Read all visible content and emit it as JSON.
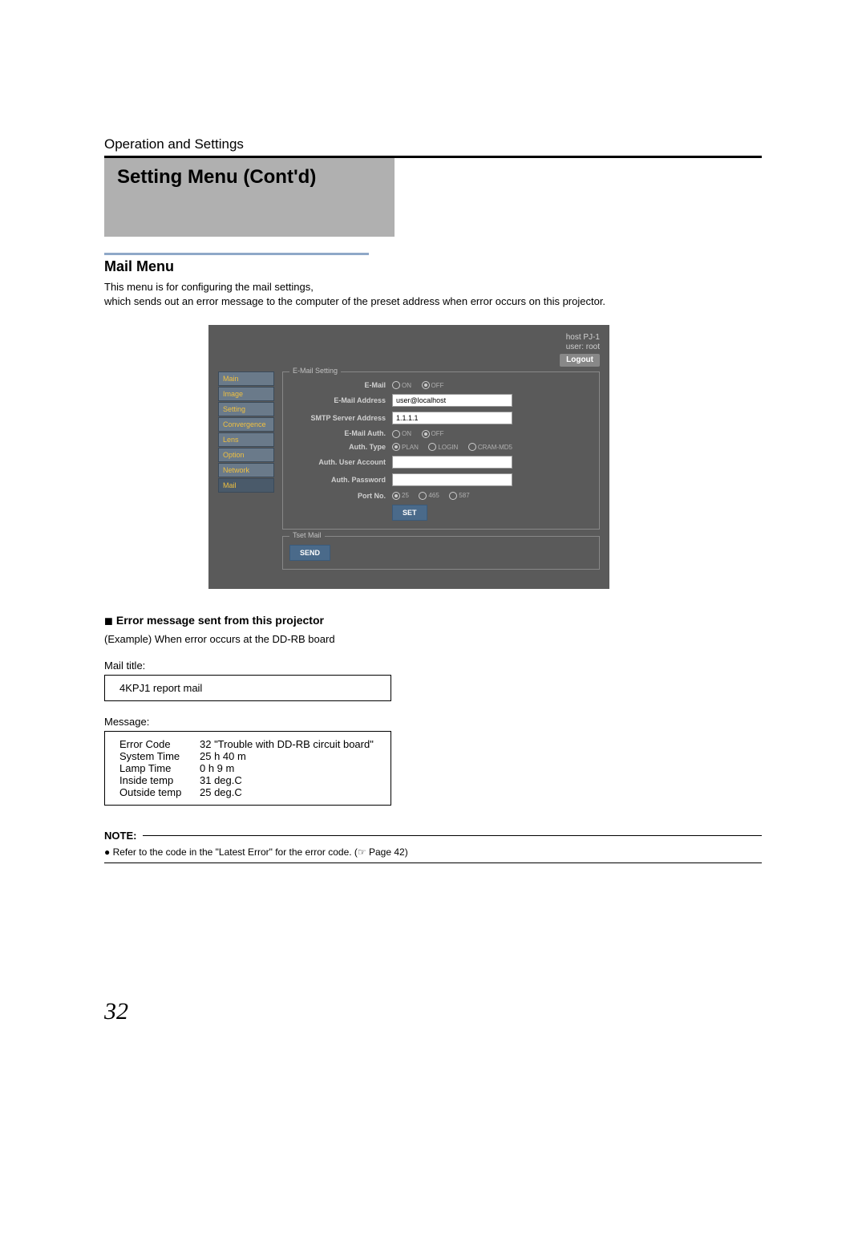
{
  "breadcrumb": "Operation and Settings",
  "banner_title": "Setting Menu (Cont'd)",
  "section_title": "Mail Menu",
  "desc_line1": "This menu is for configuring the mail settings,",
  "desc_line2": "which sends out an error message to the computer of the preset address when error occurs on this projector.",
  "ui": {
    "host": "host PJ-1",
    "user": "user: root",
    "logout": "Logout",
    "nav": [
      "Main",
      "Image",
      "Setting",
      "Convergence",
      "Lens",
      "Option",
      "Network",
      "Mail"
    ],
    "fs_email": {
      "legend": "E-Mail Setting",
      "rows": {
        "email_label": "E-Mail",
        "email_on": "ON",
        "email_off": "OFF",
        "addr_label": "E-Mail Address",
        "addr_val": "user@localhost",
        "smtp_label": "SMTP Server Address",
        "smtp_val": "1.1.1.1",
        "auth_label": "E-Mail Auth.",
        "auth_on": "ON",
        "auth_off": "OFF",
        "atype_label": "Auth. Type",
        "atype_plan": "PLAN",
        "atype_login": "LOGIN",
        "atype_cram": "CRAM-MD5",
        "acct_label": "Auth. User Account",
        "acct_val": "",
        "pass_label": "Auth. Password",
        "pass_val": "",
        "port_label": "Port No.",
        "port_25": "25",
        "port_465": "465",
        "port_587": "587",
        "set_btn": "SET"
      }
    },
    "fs_test": {
      "legend": "Tset Mail",
      "send_btn": "SEND"
    }
  },
  "sub_heading": "Error message sent from this projector",
  "example_text": "(Example) When error occurs at the DD-RB board",
  "mail_title_label": "Mail title:",
  "mail_title_value": "4KPJ1 report mail",
  "message_label": "Message:",
  "message_rows": [
    {
      "k": "Error Code",
      "v": "32 \"Trouble with DD-RB circuit board\""
    },
    {
      "k": "System Time",
      "v": "25 h 40 m"
    },
    {
      "k": "Lamp Time",
      "v": "0 h 9 m"
    },
    {
      "k": "Inside temp",
      "v": "31 deg.C"
    },
    {
      "k": "Outside temp",
      "v": "25 deg.C"
    }
  ],
  "note_label": "NOTE:",
  "note_bullet": "● Refer to the code in the \"Latest Error\" for the error code. (☞ Page 42)",
  "page_number": "32"
}
